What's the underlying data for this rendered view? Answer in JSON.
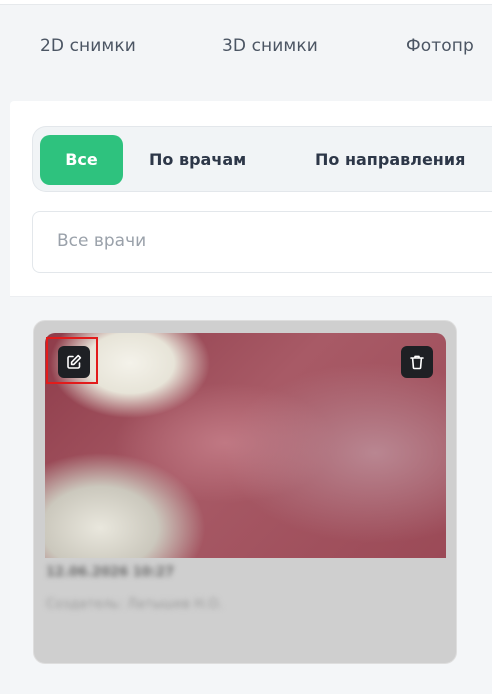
{
  "tabs": [
    "2D снимки",
    "3D снимки",
    "Фотопр"
  ],
  "filter": {
    "options": [
      "Все",
      "По врачам",
      "По направления"
    ],
    "active": "Все"
  },
  "doctor_select": {
    "placeholder": "Все врачи"
  },
  "card": {
    "date": "12.06.2026 10:27",
    "author": "Создатель: Латышев Н.О.",
    "edit_icon": "edit-icon",
    "delete_icon": "trash-icon"
  },
  "colors": {
    "accent": "#2ec27e",
    "icon_button_bg": "#1e2024",
    "highlight": "#e21b1b"
  }
}
